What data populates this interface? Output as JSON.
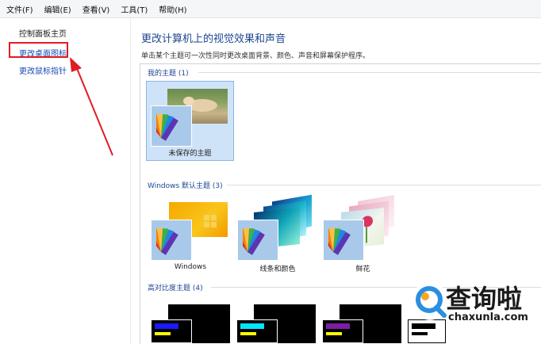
{
  "menu": [
    "文件(F)",
    "编辑(E)",
    "查看(V)",
    "工具(T)",
    "帮助(H)"
  ],
  "sidebar": {
    "items": [
      {
        "label": "控制面板主页"
      },
      {
        "label": "更改桌面图标"
      },
      {
        "label": "更改鼠标指针"
      }
    ]
  },
  "main": {
    "title": "更改计算机上的视觉效果和声音",
    "description": "单击某个主题可一次性同时更改桌面背景、颜色、声音和屏幕保护程序。",
    "groups": [
      {
        "label": "我的主题 (1)",
        "themes": [
          {
            "label": "未保存的主题",
            "selected": true
          }
        ]
      },
      {
        "label": "Windows 默认主题 (3)",
        "themes": [
          {
            "label": "Windows"
          },
          {
            "label": "线条和颜色"
          },
          {
            "label": "鲜花"
          }
        ]
      },
      {
        "label": "高对比度主题 (4)"
      }
    ]
  },
  "watermark": {
    "brand": "查询啦",
    "site": "chaxunla.com",
    "color": "#2a8fe0"
  },
  "colors": {
    "link": "#1b4bb5",
    "heading": "#1d4691",
    "highlight": "#e01c24",
    "selected_bg": "#cfe3f8"
  }
}
